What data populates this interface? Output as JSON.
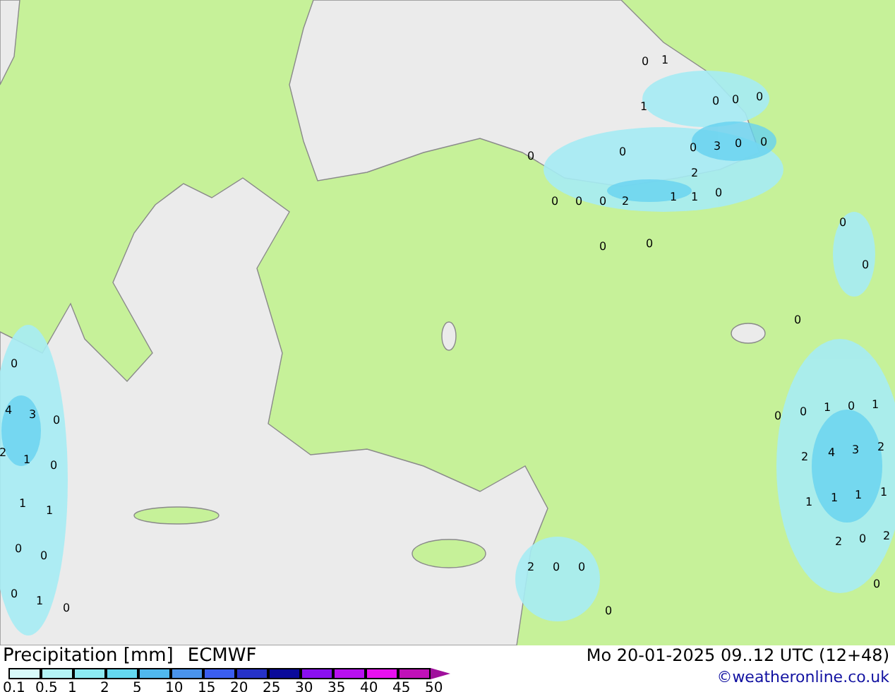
{
  "map": {
    "labels": [
      "0",
      "1",
      "1",
      "0",
      "0",
      "0",
      "0",
      "0",
      "0",
      "3",
      "0",
      "0",
      "2",
      "0",
      "0",
      "0",
      "2",
      "1",
      "1",
      "0",
      "0",
      "0",
      "0",
      "0",
      "0",
      "0",
      "4",
      "3",
      "0",
      "2",
      "1",
      "0",
      "0",
      "0",
      "1",
      "0",
      "1",
      "2",
      "4",
      "3",
      "2",
      "1",
      "1",
      "1",
      "1",
      "1",
      "1",
      "0",
      "0",
      "2",
      "0",
      "2",
      "2",
      "0",
      "0",
      "0",
      "1",
      "0",
      "0",
      "0"
    ]
  },
  "legend": {
    "title": "Precipitation [mm]",
    "model": "ECMWF",
    "bins": [
      {
        "color": "#d8fafa"
      },
      {
        "color": "#b4f4f6"
      },
      {
        "color": "#8ceaf2"
      },
      {
        "color": "#64d8f0"
      },
      {
        "color": "#50b8ee"
      },
      {
        "color": "#4a94ec"
      },
      {
        "color": "#3a5ef0"
      },
      {
        "color": "#2632c8"
      },
      {
        "color": "#0a0a9a"
      },
      {
        "color": "#8a10f0"
      },
      {
        "color": "#b810f0"
      },
      {
        "color": "#e810f0"
      },
      {
        "color": "#c010b8"
      }
    ],
    "arrow": {
      "color": "#a0109c"
    },
    "labels": [
      "0.1",
      "0.5",
      "1",
      "2",
      "5",
      "10",
      "15",
      "20",
      "25",
      "30",
      "35",
      "40",
      "45",
      "50"
    ]
  },
  "valid_time": "Mo 20-01-2025 09..12 UTC (12+48)",
  "credit": "©weatheronline.co.uk"
}
